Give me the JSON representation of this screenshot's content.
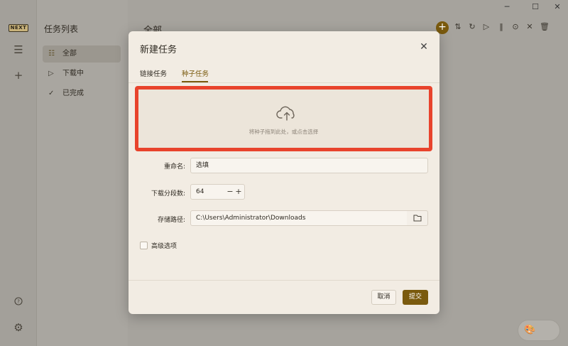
{
  "app": {
    "logo_text": "NEXT",
    "list_title": "任务列表",
    "nav": [
      {
        "label": "全部",
        "icon": "list-icon"
      },
      {
        "label": "下载中",
        "icon": "play-icon"
      },
      {
        "label": "已完成",
        "icon": "check-icon"
      }
    ],
    "main_title": "全部",
    "window_controls": [
      "minimize-icon",
      "maximize-icon",
      "close-icon"
    ],
    "toolbar_icons": [
      "add-icon",
      "sort-icon",
      "refresh-icon",
      "play-icon",
      "pause-icon",
      "stop-icon",
      "close-icon",
      "trash-icon"
    ],
    "rail_icons": [
      "menu-icon",
      "plus-icon",
      "help-icon",
      "settings-icon"
    ],
    "fab_icon": "palette-icon"
  },
  "dialog": {
    "title": "新建任务",
    "tabs": [
      {
        "label": "链接任务",
        "active": false
      },
      {
        "label": "种子任务",
        "active": true
      }
    ],
    "dropzone": {
      "icon": "cloud-upload-icon",
      "text": "将种子拖到此处，或点击选择"
    },
    "fields": {
      "rename_label": "重命名:",
      "rename_placeholder": "选填",
      "segments_label": "下载分段数:",
      "segments_value": "64",
      "path_label": "存储路径:",
      "path_value": "C:\\Users\\Administrator\\Downloads",
      "path_button_icon": "folder-icon"
    },
    "advanced_label": "高级选项",
    "advanced_checked": false,
    "cancel_label": "取消",
    "submit_label": "提交"
  },
  "colors": {
    "accent": "#7a5a0e",
    "highlight_border": "#e8432c",
    "dialog_bg": "#f2ece3"
  }
}
